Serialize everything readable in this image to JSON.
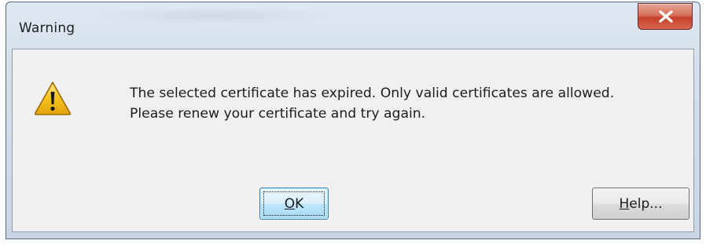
{
  "window": {
    "title": "Warning",
    "close_symbol": "x"
  },
  "dialog": {
    "icon": "warning-triangle-icon",
    "message_line1": "The selected certificate has expired. Only valid certificates are allowed.",
    "message_line2": "Please renew your certificate and try again."
  },
  "buttons": {
    "ok": {
      "mnemonic": "O",
      "rest": "K"
    },
    "help": {
      "mnemonic": "H",
      "rest": "elp..."
    }
  },
  "colors": {
    "close_button": "#c4412b",
    "warning_yellow": "#f5c21c",
    "default_button_border": "#3c7fb1"
  }
}
